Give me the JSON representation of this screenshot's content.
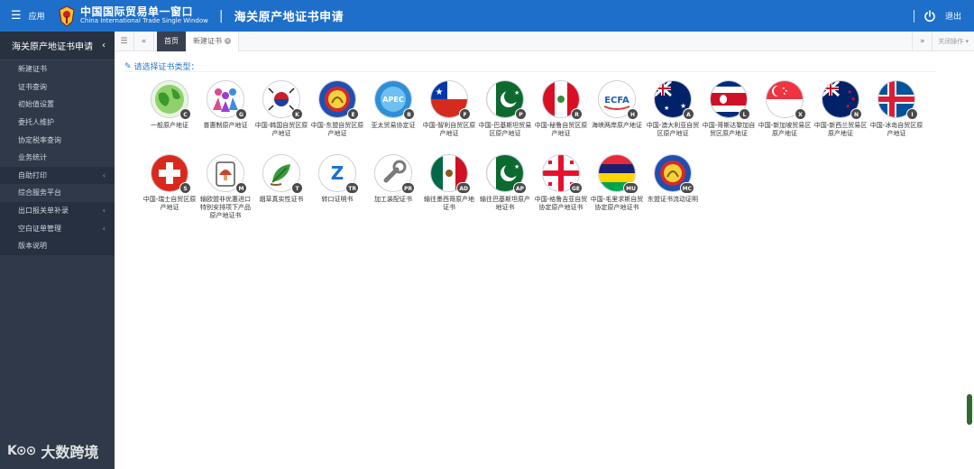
{
  "header": {
    "menu_label": "应用",
    "brand_cn": "中国国际贸易单一窗口",
    "brand_en": "China International Trade Single Window",
    "system_title": "海关原产地证书申请",
    "logout_label": "退出",
    "colors": {
      "bar": "#1d6fc9"
    }
  },
  "sidebar": {
    "title": "海关原产地证书申请",
    "items": [
      {
        "label": "新建证书",
        "dark": false,
        "expandable": false
      },
      {
        "label": "证书查询",
        "dark": false,
        "expandable": false
      },
      {
        "label": "初始值设置",
        "dark": false,
        "expandable": false
      },
      {
        "label": "委托人维护",
        "dark": false,
        "expandable": false
      },
      {
        "label": "协定税率查询",
        "dark": false,
        "expandable": false
      },
      {
        "label": "业务统计",
        "dark": false,
        "expandable": false
      },
      {
        "label": "自助打印",
        "dark": true,
        "expandable": true
      },
      {
        "label": "综合服务平台",
        "dark": false,
        "expandable": false
      },
      {
        "label": "出口报关单补录",
        "dark": true,
        "expandable": true
      },
      {
        "label": "空白证单管理",
        "dark": true,
        "expandable": true
      },
      {
        "label": "版本说明",
        "dark": true,
        "expandable": false
      }
    ]
  },
  "tabs": {
    "home": "首页",
    "active": "新建证书",
    "close_ops": "关闭操作"
  },
  "content": {
    "prompt": "请选择证书类型："
  },
  "certificates": [
    {
      "label": "一般原产地证",
      "badge": "C",
      "icon": "globe-icon"
    },
    {
      "label": "普惠制原产地证",
      "badge": "G",
      "icon": "people-icon"
    },
    {
      "label": "中国-韩国自贸区原产地证",
      "badge": "K",
      "icon": "korea-flag-icon"
    },
    {
      "label": "中国-东盟自贸区原产地证",
      "badge": "E",
      "icon": "asean-icon"
    },
    {
      "label": "亚太贸易协定证",
      "badge": "B",
      "icon": "apec-icon"
    },
    {
      "label": "中国-智利自贸区原产地证",
      "badge": "F",
      "icon": "chile-flag-icon"
    },
    {
      "label": "中国-巴基斯坦贸易区原产地证",
      "badge": "P",
      "icon": "pakistan-flag-icon"
    },
    {
      "label": "中国-秘鲁自贸区原产地证",
      "badge": "R",
      "icon": "peru-flag-icon"
    },
    {
      "label": "海峡两岸原产地证",
      "badge": "H",
      "icon": "ecfa-icon"
    },
    {
      "label": "中国-澳大利亚自贸区原产地证",
      "badge": "A",
      "icon": "australia-flag-icon"
    },
    {
      "label": "中国-哥斯达黎加自贸区原产地证",
      "badge": "L",
      "icon": "costa-rica-flag-icon"
    },
    {
      "label": "中国-新加坡贸易区原产地证",
      "badge": "X",
      "icon": "singapore-flag-icon"
    },
    {
      "label": "中国-新西兰贸易区原产地证",
      "badge": "N",
      "icon": "new-zealand-flag-icon"
    },
    {
      "label": "中国-冰岛自贸区原产地证",
      "badge": "I",
      "icon": "iceland-flag-icon"
    },
    {
      "label": "中国-瑞士自贸区原产地证",
      "badge": "S",
      "icon": "switzerland-flag-icon"
    },
    {
      "label": "输欧盟非优惠进口特别安排项下产品原产地证书",
      "badge": "M",
      "icon": "mushroom-icon"
    },
    {
      "label": "烟草真实性证书",
      "badge": "T",
      "icon": "tobacco-leaf-icon"
    },
    {
      "label": "转口证明书",
      "badge": "TR",
      "icon": "transit-z-icon"
    },
    {
      "label": "加工装配证书",
      "badge": "PR",
      "icon": "wrench-icon"
    },
    {
      "label": "输往墨西哥原产地证书",
      "badge": "AD",
      "icon": "mexico-flag-icon"
    },
    {
      "label": "输往巴基斯坦原产地证书",
      "badge": "AP",
      "icon": "pakistan-flag-icon"
    },
    {
      "label": "中国-格鲁吉亚自贸协定原产地证书",
      "badge": "GE",
      "icon": "georgia-flag-icon"
    },
    {
      "label": "中国-毛里求斯自贸协定原产地证书",
      "badge": "MU",
      "icon": "mauritius-flag-icon"
    },
    {
      "label": "东盟证书流动证明",
      "badge": "MC",
      "icon": "asean-icon"
    }
  ],
  "watermark": {
    "mark": "K⊙⊙",
    "text": "大数跨境"
  }
}
